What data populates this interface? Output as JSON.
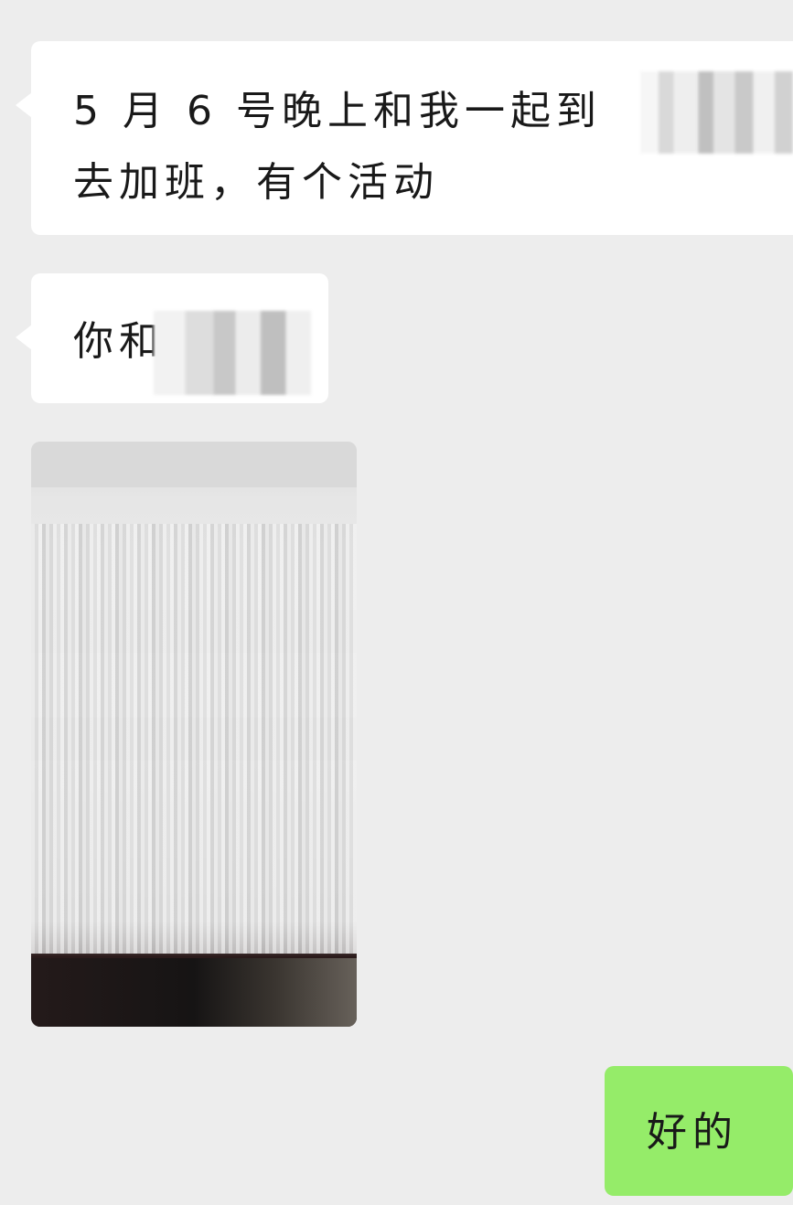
{
  "messages": {
    "m1": {
      "line1": "5 月 6 号晚上和我一起到",
      "line2": "去加班，有个活动"
    },
    "m2": {
      "line1": "你和"
    },
    "m4": {
      "line1": "好的"
    }
  },
  "colors": {
    "background": "#ededed",
    "incoming_bubble": "#ffffff",
    "outgoing_bubble": "#95ec69",
    "text": "#191919"
  }
}
